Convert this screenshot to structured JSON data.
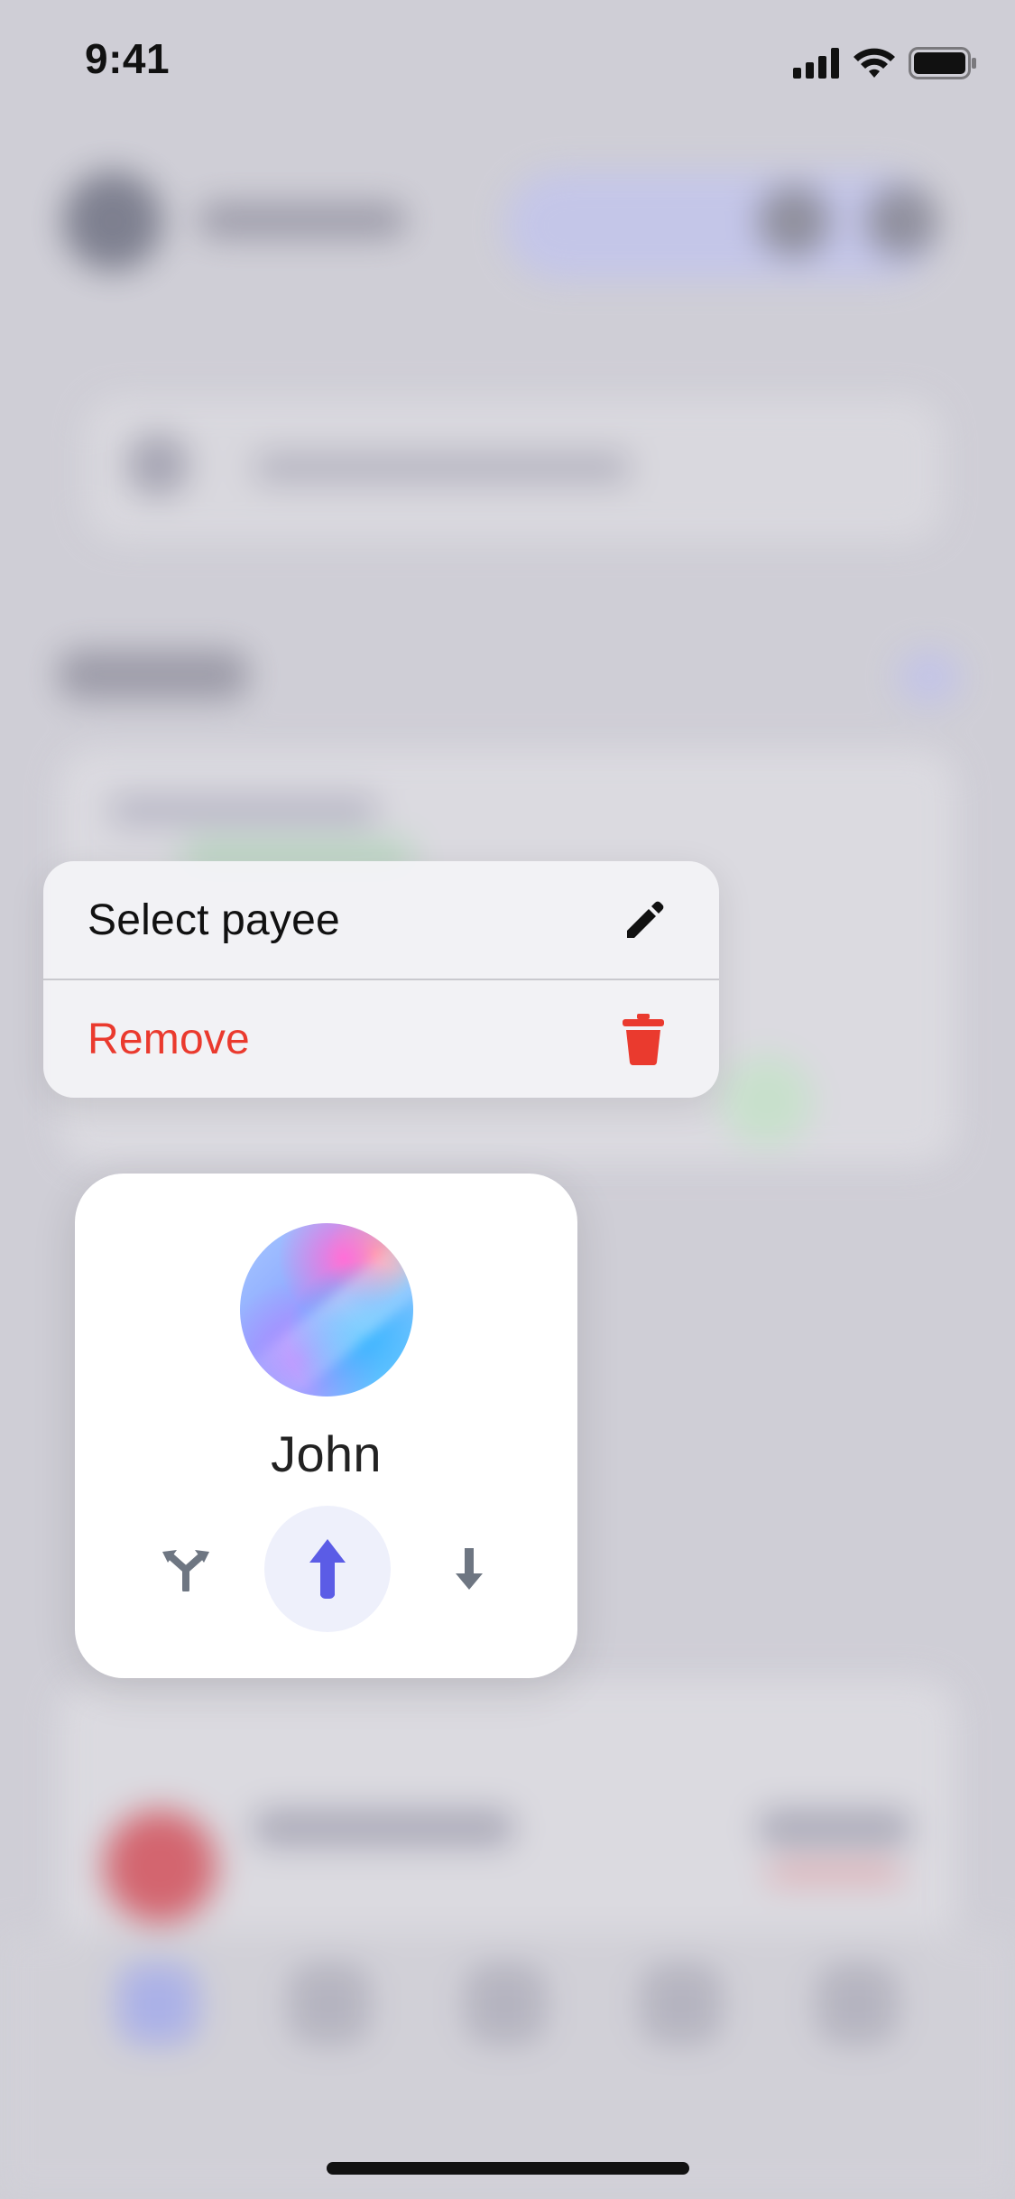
{
  "status_bar": {
    "time": "9:41",
    "icons": [
      "signal-icon",
      "wifi-icon",
      "battery-icon"
    ]
  },
  "context_menu": {
    "items": [
      {
        "label": "Select payee",
        "icon": "pencil-icon",
        "color": "#111111"
      },
      {
        "label": "Remove",
        "icon": "trash-icon",
        "color": "#ea3a2e"
      }
    ]
  },
  "contact_card": {
    "name": "John",
    "actions": [
      {
        "icon": "split-icon"
      },
      {
        "icon": "send-arrow-up-icon",
        "selected": true,
        "accent": "#5b5ce6"
      },
      {
        "icon": "receive-arrow-down-icon"
      }
    ]
  }
}
